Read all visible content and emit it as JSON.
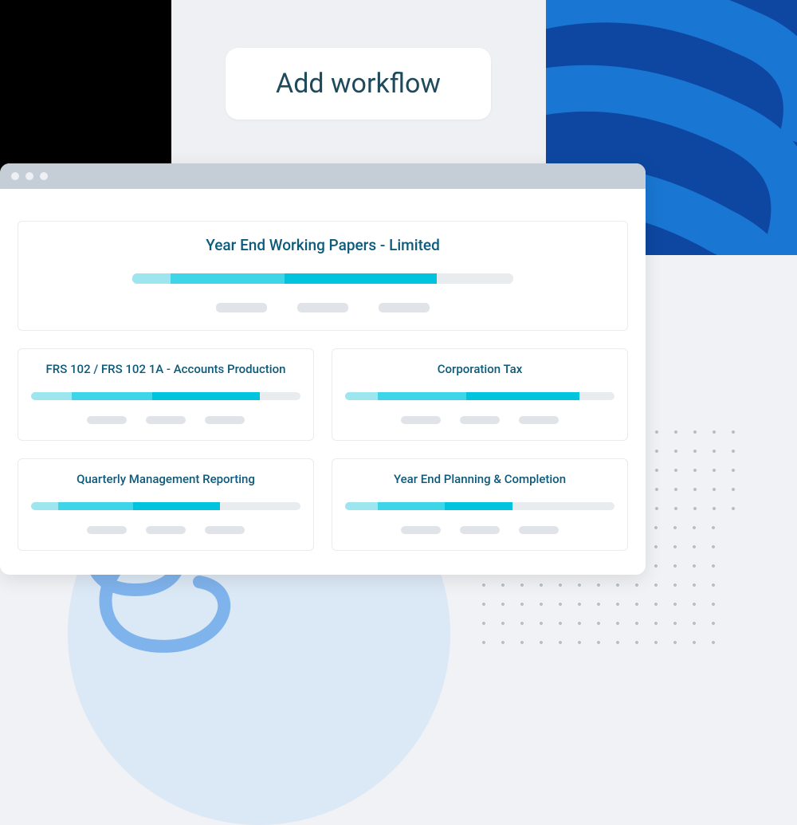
{
  "button": {
    "add_workflow": "Add workflow"
  },
  "cards": {
    "big": {
      "title": "Year End Working Papers - Limited",
      "segments": [
        10,
        30,
        40,
        20
      ]
    },
    "row1": [
      {
        "title": "FRS 102 / FRS 102 1A - Accounts Production",
        "segments": [
          15,
          30,
          40,
          15
        ]
      },
      {
        "title": "Corporation Tax",
        "segments": [
          12,
          33,
          42,
          13
        ]
      }
    ],
    "row2": [
      {
        "title": "Quarterly Management Reporting",
        "segments": [
          10,
          28,
          32,
          30
        ]
      },
      {
        "title": "Year End Planning & Completion",
        "segments": [
          12,
          25,
          25,
          38
        ]
      }
    ]
  }
}
